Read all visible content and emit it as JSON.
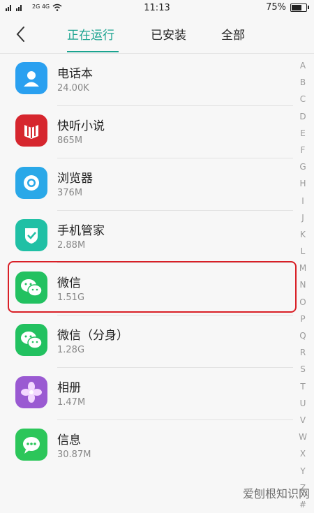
{
  "status": {
    "signal_left": "2G 4G",
    "time": "11:13",
    "battery": "75%",
    "battery_level": 0.75
  },
  "nav": {
    "back_icon": "chevron-left-icon",
    "tabs": [
      {
        "label": "正在运行",
        "active": true
      },
      {
        "label": "已安装",
        "active": false
      },
      {
        "label": "全部",
        "active": false
      }
    ],
    "accent_color": "#1aa38f"
  },
  "apps": [
    {
      "name": "电话本",
      "size": "24.00K",
      "icon": "contacts-icon",
      "color": "#2aa0f0"
    },
    {
      "name": "快听小说",
      "size": "865M",
      "icon": "book-icon",
      "color": "#d6262e"
    },
    {
      "name": "浏览器",
      "size": "376M",
      "icon": "browser-icon",
      "color": "#2aa8e8"
    },
    {
      "name": "手机管家",
      "size": "2.88M",
      "icon": "shield-icon",
      "color": "#20c0a5"
    },
    {
      "name": "微信",
      "size": "1.51G",
      "icon": "wechat-icon",
      "color": "#22c160",
      "highlighted": true
    },
    {
      "name": "微信（分身）",
      "size": "1.28G",
      "icon": "wechat-icon",
      "color": "#22c160"
    },
    {
      "name": "相册",
      "size": "1.47M",
      "icon": "flower-icon",
      "color": "#9a5ad2"
    },
    {
      "name": "信息",
      "size": "30.87M",
      "icon": "message-icon",
      "color": "#2cc65a"
    }
  ],
  "alphabet": [
    "A",
    "B",
    "C",
    "D",
    "E",
    "F",
    "G",
    "H",
    "I",
    "J",
    "K",
    "L",
    "M",
    "N",
    "O",
    "P",
    "Q",
    "R",
    "S",
    "T",
    "U",
    "V",
    "W",
    "X",
    "Y",
    "Z",
    "#"
  ],
  "watermark": "爱刨根知识网"
}
